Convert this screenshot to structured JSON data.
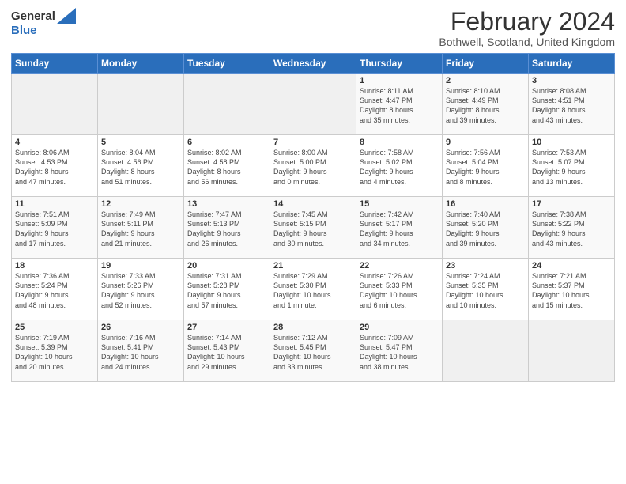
{
  "header": {
    "logo_general": "General",
    "logo_blue": "Blue",
    "month_title": "February 2024",
    "location": "Bothwell, Scotland, United Kingdom"
  },
  "days_of_week": [
    "Sunday",
    "Monday",
    "Tuesday",
    "Wednesday",
    "Thursday",
    "Friday",
    "Saturday"
  ],
  "weeks": [
    [
      {
        "day": "",
        "info": ""
      },
      {
        "day": "",
        "info": ""
      },
      {
        "day": "",
        "info": ""
      },
      {
        "day": "",
        "info": ""
      },
      {
        "day": "1",
        "info": "Sunrise: 8:11 AM\nSunset: 4:47 PM\nDaylight: 8 hours\nand 35 minutes."
      },
      {
        "day": "2",
        "info": "Sunrise: 8:10 AM\nSunset: 4:49 PM\nDaylight: 8 hours\nand 39 minutes."
      },
      {
        "day": "3",
        "info": "Sunrise: 8:08 AM\nSunset: 4:51 PM\nDaylight: 8 hours\nand 43 minutes."
      }
    ],
    [
      {
        "day": "4",
        "info": "Sunrise: 8:06 AM\nSunset: 4:53 PM\nDaylight: 8 hours\nand 47 minutes."
      },
      {
        "day": "5",
        "info": "Sunrise: 8:04 AM\nSunset: 4:56 PM\nDaylight: 8 hours\nand 51 minutes."
      },
      {
        "day": "6",
        "info": "Sunrise: 8:02 AM\nSunset: 4:58 PM\nDaylight: 8 hours\nand 56 minutes."
      },
      {
        "day": "7",
        "info": "Sunrise: 8:00 AM\nSunset: 5:00 PM\nDaylight: 9 hours\nand 0 minutes."
      },
      {
        "day": "8",
        "info": "Sunrise: 7:58 AM\nSunset: 5:02 PM\nDaylight: 9 hours\nand 4 minutes."
      },
      {
        "day": "9",
        "info": "Sunrise: 7:56 AM\nSunset: 5:04 PM\nDaylight: 9 hours\nand 8 minutes."
      },
      {
        "day": "10",
        "info": "Sunrise: 7:53 AM\nSunset: 5:07 PM\nDaylight: 9 hours\nand 13 minutes."
      }
    ],
    [
      {
        "day": "11",
        "info": "Sunrise: 7:51 AM\nSunset: 5:09 PM\nDaylight: 9 hours\nand 17 minutes."
      },
      {
        "day": "12",
        "info": "Sunrise: 7:49 AM\nSunset: 5:11 PM\nDaylight: 9 hours\nand 21 minutes."
      },
      {
        "day": "13",
        "info": "Sunrise: 7:47 AM\nSunset: 5:13 PM\nDaylight: 9 hours\nand 26 minutes."
      },
      {
        "day": "14",
        "info": "Sunrise: 7:45 AM\nSunset: 5:15 PM\nDaylight: 9 hours\nand 30 minutes."
      },
      {
        "day": "15",
        "info": "Sunrise: 7:42 AM\nSunset: 5:17 PM\nDaylight: 9 hours\nand 34 minutes."
      },
      {
        "day": "16",
        "info": "Sunrise: 7:40 AM\nSunset: 5:20 PM\nDaylight: 9 hours\nand 39 minutes."
      },
      {
        "day": "17",
        "info": "Sunrise: 7:38 AM\nSunset: 5:22 PM\nDaylight: 9 hours\nand 43 minutes."
      }
    ],
    [
      {
        "day": "18",
        "info": "Sunrise: 7:36 AM\nSunset: 5:24 PM\nDaylight: 9 hours\nand 48 minutes."
      },
      {
        "day": "19",
        "info": "Sunrise: 7:33 AM\nSunset: 5:26 PM\nDaylight: 9 hours\nand 52 minutes."
      },
      {
        "day": "20",
        "info": "Sunrise: 7:31 AM\nSunset: 5:28 PM\nDaylight: 9 hours\nand 57 minutes."
      },
      {
        "day": "21",
        "info": "Sunrise: 7:29 AM\nSunset: 5:30 PM\nDaylight: 10 hours\nand 1 minute."
      },
      {
        "day": "22",
        "info": "Sunrise: 7:26 AM\nSunset: 5:33 PM\nDaylight: 10 hours\nand 6 minutes."
      },
      {
        "day": "23",
        "info": "Sunrise: 7:24 AM\nSunset: 5:35 PM\nDaylight: 10 hours\nand 10 minutes."
      },
      {
        "day": "24",
        "info": "Sunrise: 7:21 AM\nSunset: 5:37 PM\nDaylight: 10 hours\nand 15 minutes."
      }
    ],
    [
      {
        "day": "25",
        "info": "Sunrise: 7:19 AM\nSunset: 5:39 PM\nDaylight: 10 hours\nand 20 minutes."
      },
      {
        "day": "26",
        "info": "Sunrise: 7:16 AM\nSunset: 5:41 PM\nDaylight: 10 hours\nand 24 minutes."
      },
      {
        "day": "27",
        "info": "Sunrise: 7:14 AM\nSunset: 5:43 PM\nDaylight: 10 hours\nand 29 minutes."
      },
      {
        "day": "28",
        "info": "Sunrise: 7:12 AM\nSunset: 5:45 PM\nDaylight: 10 hours\nand 33 minutes."
      },
      {
        "day": "29",
        "info": "Sunrise: 7:09 AM\nSunset: 5:47 PM\nDaylight: 10 hours\nand 38 minutes."
      },
      {
        "day": "",
        "info": ""
      },
      {
        "day": "",
        "info": ""
      }
    ]
  ]
}
